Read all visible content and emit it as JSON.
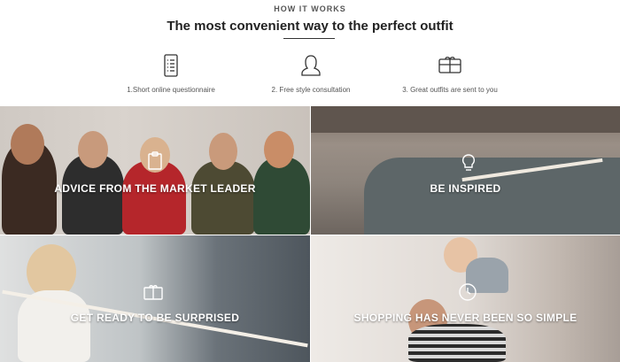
{
  "how_it_works": {
    "eyebrow": "HOW IT WORKS",
    "headline": "The most convenient way to the perfect outfit",
    "steps": [
      {
        "icon": "questionnaire-icon",
        "label": "1.Short online questionnaire"
      },
      {
        "icon": "stylist-icon",
        "label": "2. Free style consultation"
      },
      {
        "icon": "box-icon",
        "label": "3. Great outfits are sent to you"
      }
    ]
  },
  "tiles": [
    {
      "icon": "clipboard-icon",
      "caption": "ADVICE FROM THE MARKET LEADER"
    },
    {
      "icon": "lightbulb-icon",
      "caption": "BE INSPIRED"
    },
    {
      "icon": "box-icon",
      "caption": "GET READY TO BE SURPRISED"
    },
    {
      "icon": "clock-icon",
      "caption": "SHOPPING HAS NEVER BEEN SO SIMPLE"
    }
  ],
  "colors": {
    "text": "#2b2b2b",
    "caption": "#ffffff",
    "rule": "#333333"
  }
}
